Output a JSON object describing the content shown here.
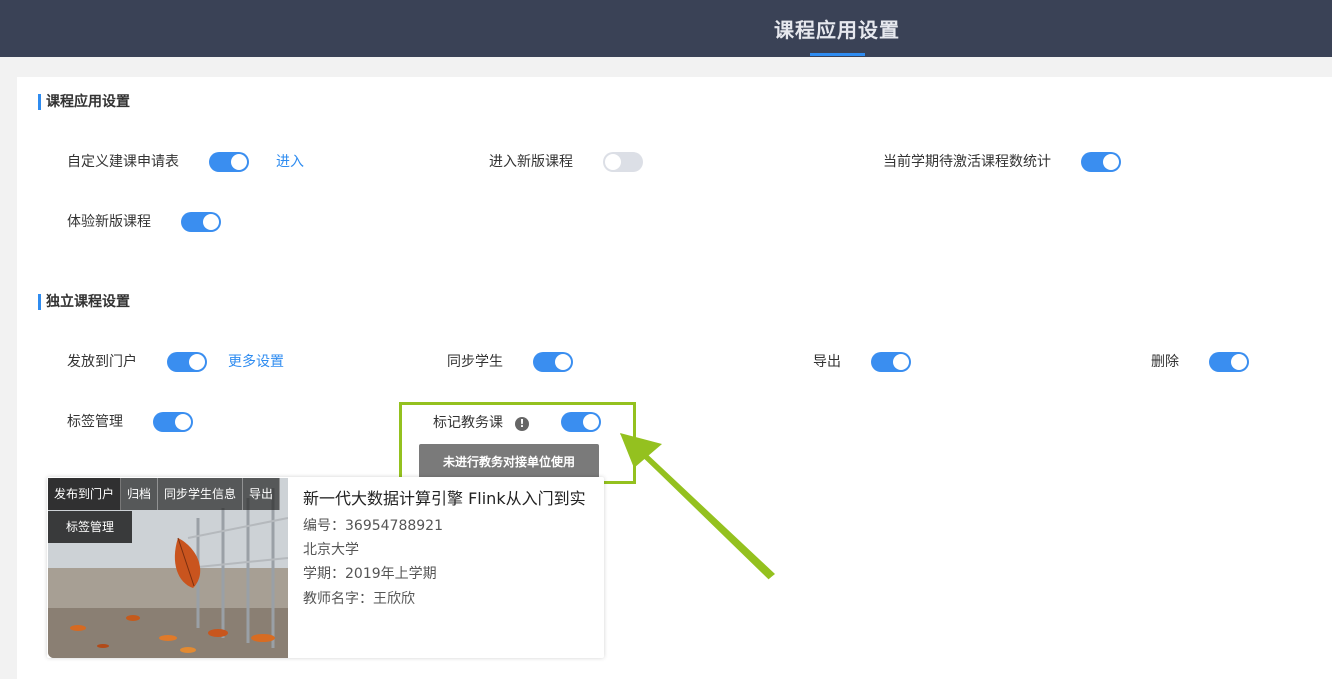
{
  "header": {
    "title": "课程应用设置"
  },
  "section1": {
    "title": "课程应用设置",
    "items": [
      {
        "label": "自定义建课申请表",
        "on": true,
        "link": "进入"
      },
      {
        "label": "进入新版课程",
        "on": false
      },
      {
        "label": "当前学期待激活课程数统计",
        "on": true
      },
      {
        "label": "体验新版课程",
        "on": true
      }
    ]
  },
  "section2": {
    "title": "独立课程设置",
    "items": [
      {
        "label": "发放到门户",
        "on": true,
        "link": "更多设置"
      },
      {
        "label": "同步学生",
        "on": true
      },
      {
        "label": "导出",
        "on": true
      },
      {
        "label": "删除",
        "on": true
      },
      {
        "label": "标签管理",
        "on": true
      },
      {
        "label": "标记教务课",
        "on": true,
        "info_icon": "exclamation-info-icon"
      }
    ],
    "notice_button": "未进行教务对接单位使用"
  },
  "course_card": {
    "actions": [
      "发布到门户",
      "归档",
      "同步学生信息",
      "导出",
      "标签管理"
    ],
    "title": "新一代大数据计算引擎 Flink从入门到实",
    "code": "编号：36954788921",
    "school": "北京大学",
    "term": "学期：2019年上学期",
    "teacher": "教师名字：王欣欣"
  },
  "colors": {
    "topbar": "#3a4256",
    "accent": "#2f8cf0",
    "toggle_on": "#3a8ef0",
    "toggle_off": "#dcdfe6",
    "highlight": "#94c11f"
  }
}
